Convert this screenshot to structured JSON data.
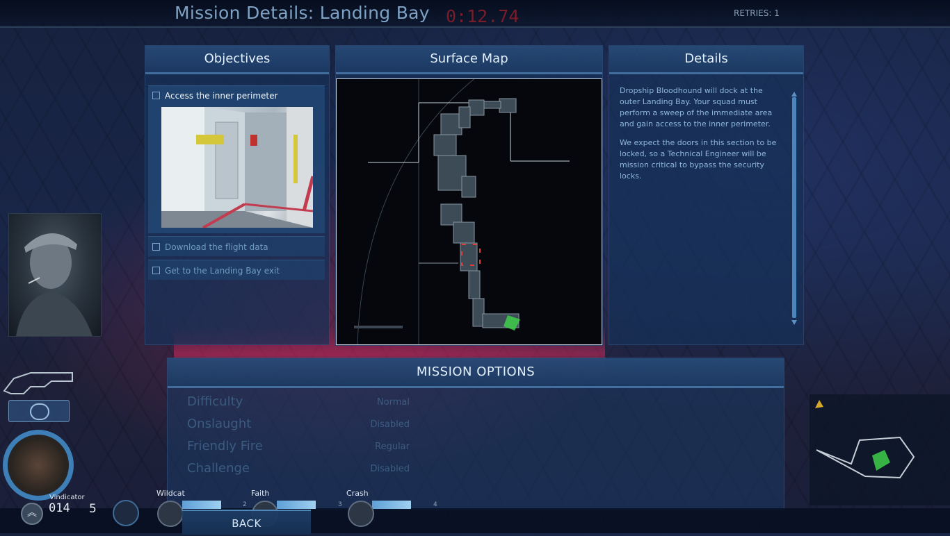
{
  "header": {
    "title": "Mission Details: Landing Bay",
    "timer": "0:12.74",
    "retries": "RETRIES: 1"
  },
  "objectives": {
    "title": "Objectives",
    "items": [
      {
        "label": "Access the inner perimeter"
      },
      {
        "label": "Download the flight data"
      },
      {
        "label": "Get to the Landing Bay exit"
      }
    ]
  },
  "surface_map": {
    "title": "Surface Map"
  },
  "details": {
    "title": "Details",
    "paragraphs": [
      "Dropship Bloodhound will dock at the outer Landing Bay.  Your squad must perform a sweep of the immediate area and gain access to the inner perimeter.",
      "We expect the doors in this section to be locked, so a Technical Engineer will be mission critical to bypass the security locks."
    ]
  },
  "mission_options": {
    "title": "MISSION OPTIONS",
    "options": [
      {
        "label": "Difficulty",
        "value": "Normal"
      },
      {
        "label": "Onslaught",
        "value": "Disabled"
      },
      {
        "label": "Friendly Fire",
        "value": "Regular"
      },
      {
        "label": "Challenge",
        "value": "Disabled"
      }
    ]
  },
  "squad": {
    "leader": {
      "name": "Vindicator",
      "ammo": "014",
      "grenades": "5"
    },
    "members": [
      {
        "name": "Wildcat",
        "count": "2"
      },
      {
        "name": "Faith",
        "count": "3"
      },
      {
        "name": "Crash",
        "count": "4"
      }
    ]
  },
  "back_label": "BACK",
  "colors": {
    "accent": "#4a86bb",
    "timer": "#7a1d2a",
    "panel": "#163058"
  }
}
